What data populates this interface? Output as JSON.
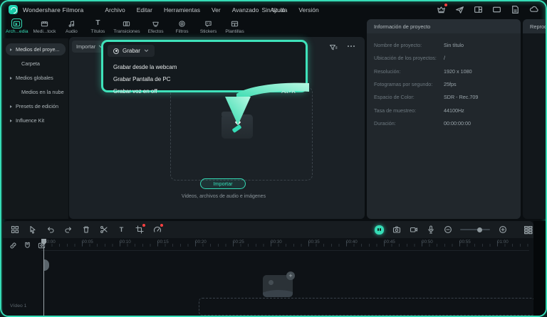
{
  "titlebar": {
    "app_name": "Wondershare Filmora",
    "menus": [
      "Archivo",
      "Editar",
      "Herramientas",
      "Ver",
      "Avanzado",
      "Ayuda",
      "Versión"
    ],
    "document_title": "Sin título"
  },
  "tabs": [
    {
      "label": "Arch...edia",
      "active": true
    },
    {
      "label": "Medi...tock",
      "active": false
    },
    {
      "label": "Audio",
      "active": false
    },
    {
      "label": "Títulos",
      "active": false
    },
    {
      "label": "Transiciones",
      "active": false
    },
    {
      "label": "Efectos",
      "active": false
    },
    {
      "label": "Filtros",
      "active": false
    },
    {
      "label": "Stickers",
      "active": false
    },
    {
      "label": "Plantillas",
      "active": false
    }
  ],
  "sidebar": {
    "items": [
      {
        "label": "Medios del proye...",
        "selected": true
      },
      {
        "label": "Carpeta",
        "selected": false
      },
      {
        "label": "Medios globales",
        "selected": false
      },
      {
        "label": "Medios en la nube",
        "selected": false
      },
      {
        "label": "Presets de edición",
        "selected": false
      },
      {
        "label": "Influence Kit",
        "selected": false
      }
    ]
  },
  "media": {
    "import_label": "Importar",
    "record_label": "Grabar",
    "menu": [
      {
        "label": "Grabar desde la webcam",
        "shortcut": ""
      },
      {
        "label": "Grabar Pantalla de PC",
        "shortcut": ""
      },
      {
        "label": "Grabar voz en off",
        "shortcut": "Alt+R"
      }
    ],
    "dropzone": {
      "button_label": "Importar",
      "caption": "Videos, archivos de audio e imágenes"
    }
  },
  "project_info": {
    "title": "Información de proyecto",
    "rows": [
      {
        "label": "Nombre de proyecto:",
        "value": "Sin título"
      },
      {
        "label": "Ubicación de los proyectos:",
        "value": "/"
      },
      {
        "label": "Resolución:",
        "value": "1920 x 1080"
      },
      {
        "label": "Fotogramas por segundo:",
        "value": "25fps"
      },
      {
        "label": "Espacio de Color:",
        "value": "SDR - Rec.709"
      },
      {
        "label": "Tasa de muestreo:",
        "value": "44100Hz"
      },
      {
        "label": "Duración:",
        "value": "00:00:00:00"
      }
    ]
  },
  "player": {
    "title": "Reproductor"
  },
  "timeline": {
    "ruler": [
      "00:00",
      "00:05",
      "00:10",
      "00:15",
      "00:20",
      "00:25",
      "00:30",
      "00:35",
      "00:40",
      "00:45",
      "00:50",
      "00:55",
      "01:00"
    ],
    "track_label": "Vídeo 1"
  },
  "colors": {
    "accent": "#35dcb6",
    "panel": "#1b2126",
    "background": "#0a0e11"
  }
}
